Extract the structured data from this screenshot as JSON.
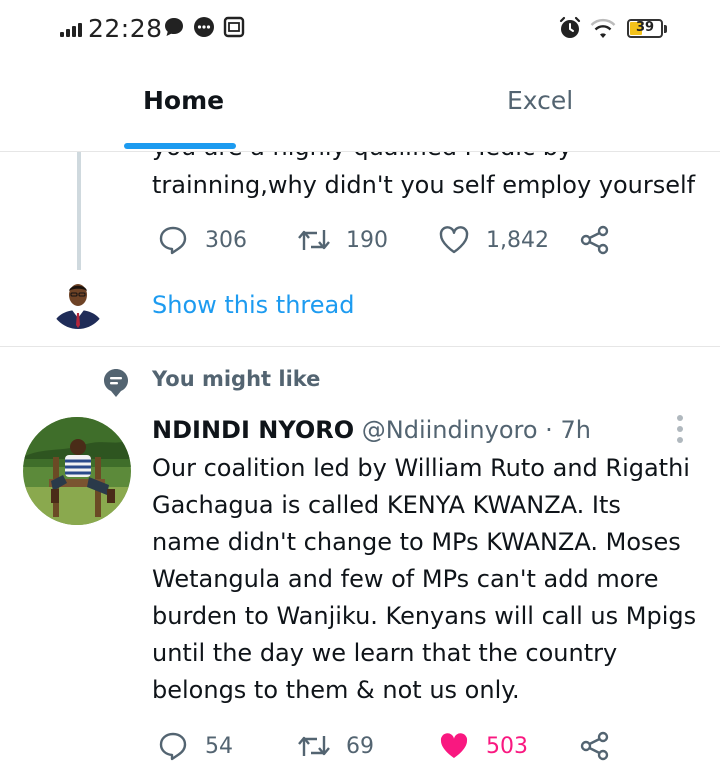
{
  "status_bar": {
    "time": "22:28",
    "battery_level": "39",
    "icons": [
      "signal-icon",
      "chat-bubble-icon",
      "message-dots-icon",
      "gallery-icon",
      "alarm-icon",
      "wifi-icon",
      "battery-icon"
    ]
  },
  "tabs": [
    {
      "label": "Home",
      "active": true
    },
    {
      "label": "Excel",
      "active": false
    }
  ],
  "colors": {
    "accent": "#1d9bf0",
    "like": "#f91880",
    "muted": "#536471",
    "text": "#0f1419"
  },
  "tweet1": {
    "cut_line": "you are a highly qualified Medic by",
    "text_line": "trainning,why didn't you self employ yourself",
    "replies": "306",
    "retweets": "190",
    "likes": "1,842",
    "show_thread": "Show this thread"
  },
  "suggestion_header": "You might like",
  "tweet2": {
    "name": "NDINDI NYORO",
    "handle": "@Ndiindinyoro",
    "separator": "·",
    "time": "7h",
    "lines": [
      "Our coalition led by William Ruto and Rigathi",
      "Gachagua is called KENYA KWANZA. Its",
      "name didn't change to MPs KWANZA. Moses",
      "Wetangula and few of MPs can't add more",
      "burden to Wanjiku. Kenyans will call us Mpigs",
      "until the day we learn that the country",
      "belongs to them & not us only."
    ],
    "replies": "54",
    "retweets": "69",
    "likes": "503",
    "liked": true
  }
}
